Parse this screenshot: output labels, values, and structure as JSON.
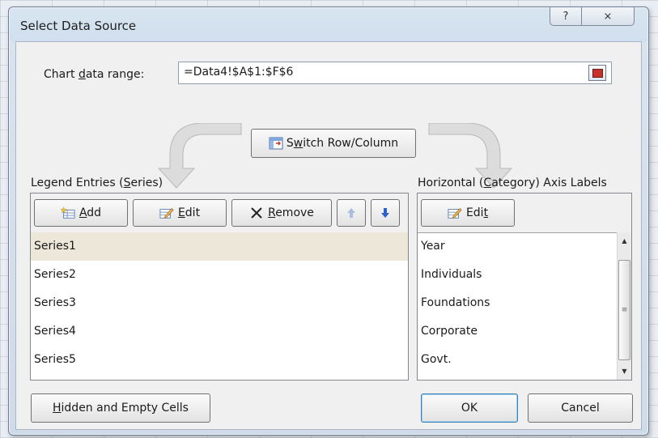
{
  "dialog": {
    "title": "Select Data Source",
    "help_glyph": "?",
    "close_glyph": "⨯"
  },
  "chart_data_range": {
    "label_pre": "Chart ",
    "label_u": "d",
    "label_post": "ata range:",
    "value": "=Data4!$A$1:$F$6"
  },
  "switch": {
    "pre": "S",
    "label_u": "w",
    "post": "itch Row/Column"
  },
  "legend": {
    "label_pre": "Legend Entries (",
    "label_u": "S",
    "label_post": "eries)",
    "add_u": "A",
    "add_post": "dd",
    "edit_u": "E",
    "edit_post": "dit",
    "remove_u": "R",
    "remove_post": "emove",
    "items": [
      "Series1",
      "Series2",
      "Series3",
      "Series4",
      "Series5"
    ]
  },
  "axis": {
    "label_pre": "Horizontal (",
    "label_u": "C",
    "label_post": "ategory) Axis Labels",
    "edit_pre": "Edi",
    "edit_u": "t",
    "items": [
      "Year",
      "Individuals",
      "Foundations",
      "Corporate",
      "Govt."
    ]
  },
  "footer": {
    "hidden_u": "H",
    "hidden_post": "idden and Empty Cells",
    "ok": "OK",
    "cancel": "Cancel"
  },
  "colors": {
    "selected_row": "#ece7d9",
    "arrow_blue": "#2a62c9"
  }
}
